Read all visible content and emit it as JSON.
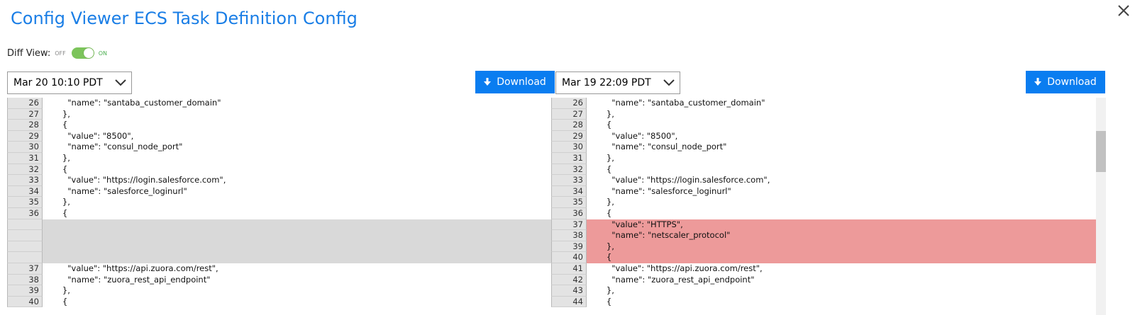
{
  "title": "Config Viewer ECS Task Definition Config",
  "diff_view": {
    "label": "Diff View:",
    "off": "OFF",
    "on": "ON",
    "enabled": true
  },
  "left": {
    "date": "Mar 20 10:10 PDT",
    "download": "Download",
    "lines": [
      {
        "num": "26",
        "text": "        \"name\": \"santaba_customer_domain\"",
        "type": "normal"
      },
      {
        "num": "27",
        "text": "      },",
        "type": "normal"
      },
      {
        "num": "28",
        "text": "      {",
        "type": "normal"
      },
      {
        "num": "29",
        "text": "        \"value\": \"8500\",",
        "type": "normal"
      },
      {
        "num": "30",
        "text": "        \"name\": \"consul_node_port\"",
        "type": "normal"
      },
      {
        "num": "31",
        "text": "      },",
        "type": "normal"
      },
      {
        "num": "32",
        "text": "      {",
        "type": "normal"
      },
      {
        "num": "33",
        "text": "        \"value\": \"https://login.salesforce.com\",",
        "type": "normal"
      },
      {
        "num": "34",
        "text": "        \"name\": \"salesforce_loginurl\"",
        "type": "normal"
      },
      {
        "num": "35",
        "text": "      },",
        "type": "normal"
      },
      {
        "num": "36",
        "text": "      {",
        "type": "normal"
      },
      {
        "num": "",
        "text": "",
        "type": "blank"
      },
      {
        "num": "",
        "text": "",
        "type": "blank"
      },
      {
        "num": "",
        "text": "",
        "type": "blank"
      },
      {
        "num": "",
        "text": "",
        "type": "blank"
      },
      {
        "num": "37",
        "text": "        \"value\": \"https://api.zuora.com/rest\",",
        "type": "normal"
      },
      {
        "num": "38",
        "text": "        \"name\": \"zuora_rest_api_endpoint\"",
        "type": "normal"
      },
      {
        "num": "39",
        "text": "      },",
        "type": "normal"
      },
      {
        "num": "40",
        "text": "      {",
        "type": "normal"
      }
    ]
  },
  "right": {
    "date": "Mar 19 22:09 PDT",
    "download": "Download",
    "lines": [
      {
        "num": "26",
        "text": "        \"name\": \"santaba_customer_domain\"",
        "type": "normal"
      },
      {
        "num": "27",
        "text": "      },",
        "type": "normal"
      },
      {
        "num": "28",
        "text": "      {",
        "type": "normal"
      },
      {
        "num": "29",
        "text": "        \"value\": \"8500\",",
        "type": "normal"
      },
      {
        "num": "30",
        "text": "        \"name\": \"consul_node_port\"",
        "type": "normal"
      },
      {
        "num": "31",
        "text": "      },",
        "type": "normal"
      },
      {
        "num": "32",
        "text": "      {",
        "type": "normal"
      },
      {
        "num": "33",
        "text": "        \"value\": \"https://login.salesforce.com\",",
        "type": "normal"
      },
      {
        "num": "34",
        "text": "        \"name\": \"salesforce_loginurl\"",
        "type": "normal"
      },
      {
        "num": "35",
        "text": "      },",
        "type": "normal"
      },
      {
        "num": "36",
        "text": "      {",
        "type": "normal"
      },
      {
        "num": "37",
        "text": "        \"value\": \"HTTPS\",",
        "type": "added"
      },
      {
        "num": "38",
        "text": "        \"name\": \"netscaler_protocol\"",
        "type": "added"
      },
      {
        "num": "39",
        "text": "      },",
        "type": "added"
      },
      {
        "num": "40",
        "text": "      {",
        "type": "added"
      },
      {
        "num": "41",
        "text": "        \"value\": \"https://api.zuora.com/rest\",",
        "type": "normal"
      },
      {
        "num": "42",
        "text": "        \"name\": \"zuora_rest_api_endpoint\"",
        "type": "normal"
      },
      {
        "num": "43",
        "text": "      },",
        "type": "normal"
      },
      {
        "num": "44",
        "text": "      {",
        "type": "normal"
      }
    ]
  },
  "colors": {
    "accent": "#0a7df0",
    "title": "#1a7ee6",
    "added": "#ed9a9a",
    "blank": "#d9d9d9",
    "toggle": "#7cc45b"
  }
}
